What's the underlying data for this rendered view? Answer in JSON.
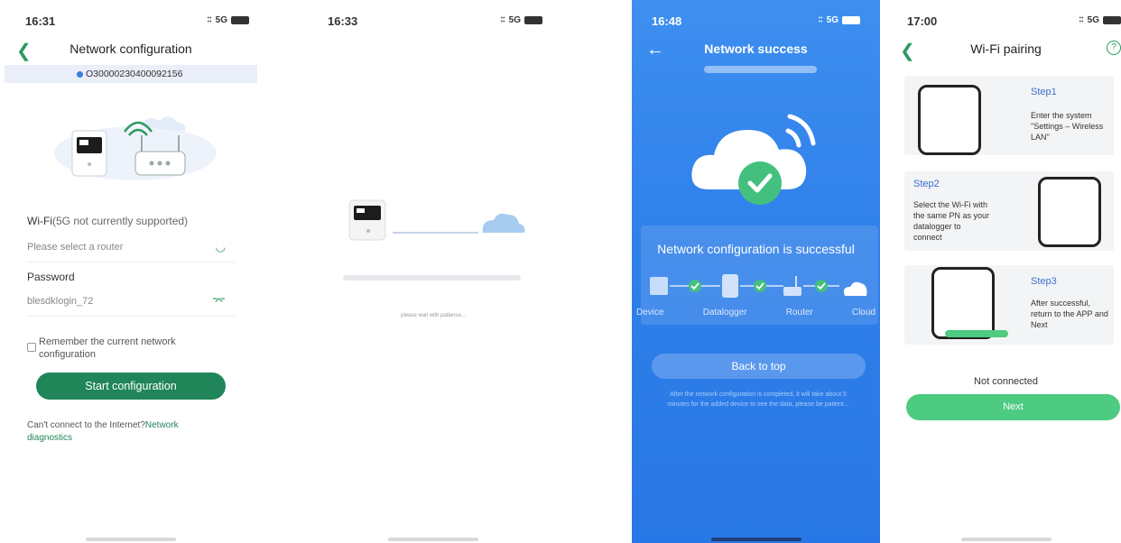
{
  "colors": {
    "green": "#21855a",
    "light_green": "#4dcb80",
    "blue_bg": "#2f80ea",
    "step_title": "#3b6fd0"
  },
  "screen1": {
    "time": "16:31",
    "network": "5G",
    "title": "Network configuration",
    "serial": "O30000230400092156",
    "wifi_label": "Wi-Fi",
    "wifi_note": "(5G not currently supported)",
    "router_placeholder": "Please select a router",
    "password_label": "Password",
    "password_value": "blesdklogin_72",
    "remember_label": "Remember the current network configuration",
    "start_button": "Start configuration",
    "help_text": "Can't connect to the Internet?",
    "help_link": "Network diagnostics"
  },
  "screen2": {
    "time": "16:33",
    "network": "5G",
    "wait_text": "please wait with patience..."
  },
  "screen3": {
    "time": "16:48",
    "network": "5G",
    "title": "Network success",
    "success_text": "Network configuration is successful",
    "steps": [
      "Device",
      "Datalogger",
      "Router",
      "Cloud"
    ],
    "back_button": "Back to top",
    "note": "After the network configuration is completed, it will take about 5 minutes for the added device to see the data, please be patient..."
  },
  "screen4": {
    "time": "17:00",
    "network": "5G",
    "title": "Wi-Fi pairing",
    "step1_title": "Step1",
    "step1_desc": "Enter the system \"Settings – Wireless LAN\"",
    "step2_title": "Step2",
    "step2_desc": "Select the Wi-Fi with the same PN as your datalogger to connect",
    "step3_title": "Step3",
    "step3_desc": "After successful, return to the APP and Next",
    "status": "Not connected",
    "next_button": "Next"
  }
}
